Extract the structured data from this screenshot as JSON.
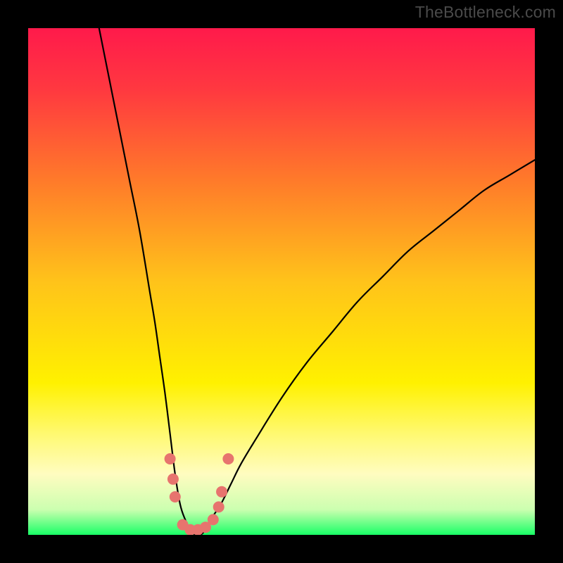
{
  "watermark": "TheBottleneck.com",
  "chart_data": {
    "type": "line",
    "title": "",
    "xlabel": "",
    "ylabel": "",
    "xlim": [
      0,
      100
    ],
    "ylim": [
      0,
      100
    ],
    "grid": false,
    "legend": false,
    "gradient_stops": [
      {
        "offset": 0.0,
        "color": "#ff1a4b"
      },
      {
        "offset": 0.12,
        "color": "#ff3840"
      },
      {
        "offset": 0.3,
        "color": "#ff7a2a"
      },
      {
        "offset": 0.5,
        "color": "#ffc31a"
      },
      {
        "offset": 0.7,
        "color": "#fff100"
      },
      {
        "offset": 0.8,
        "color": "#fff970"
      },
      {
        "offset": 0.88,
        "color": "#fffcc0"
      },
      {
        "offset": 0.95,
        "color": "#ccffb0"
      },
      {
        "offset": 1.0,
        "color": "#19ff66"
      }
    ],
    "series": [
      {
        "name": "bottleneck-curve",
        "color": "#000000",
        "x": [
          14,
          16,
          18,
          20,
          22,
          24,
          25,
          26,
          27,
          28,
          29,
          30,
          31,
          32,
          33,
          34,
          35,
          36,
          38,
          40,
          42,
          45,
          50,
          55,
          60,
          65,
          70,
          75,
          80,
          85,
          90,
          95,
          100
        ],
        "y": [
          100,
          90,
          80,
          70,
          60,
          48,
          42,
          35,
          28,
          20,
          12,
          6,
          3,
          1,
          0,
          0,
          1,
          3,
          6,
          10,
          14,
          19,
          27,
          34,
          40,
          46,
          51,
          56,
          60,
          64,
          68,
          71,
          74
        ]
      }
    ],
    "markers": {
      "name": "spline-dots",
      "color": "#e7746e",
      "radius_px": 8,
      "points": [
        {
          "x": 28.0,
          "y": 15.0
        },
        {
          "x": 28.6,
          "y": 11.0
        },
        {
          "x": 29.0,
          "y": 7.5
        },
        {
          "x": 30.5,
          "y": 2.0
        },
        {
          "x": 32.0,
          "y": 1.0
        },
        {
          "x": 33.5,
          "y": 1.0
        },
        {
          "x": 35.0,
          "y": 1.5
        },
        {
          "x": 36.5,
          "y": 3.0
        },
        {
          "x": 37.6,
          "y": 5.5
        },
        {
          "x": 38.2,
          "y": 8.5
        },
        {
          "x": 39.5,
          "y": 15.0
        }
      ]
    }
  }
}
